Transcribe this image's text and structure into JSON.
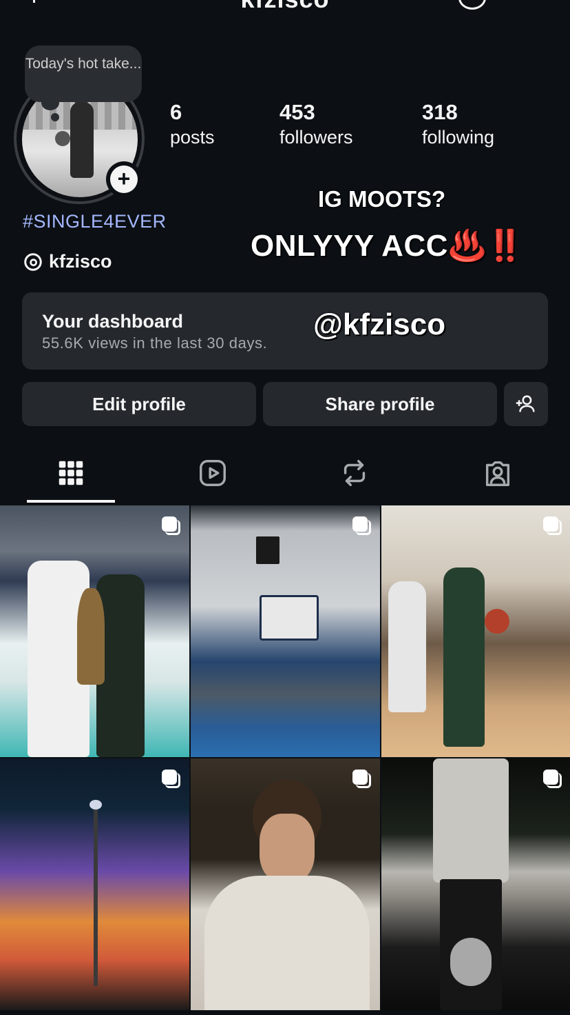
{
  "header": {
    "username_title": "kfzisco"
  },
  "profile": {
    "note_text": "Today's hot take...",
    "add_story_symbol": "+",
    "stats": [
      {
        "value": "6",
        "label": "posts"
      },
      {
        "value": "453",
        "label": "followers"
      },
      {
        "value": "318",
        "label": "following"
      }
    ],
    "bio_hashtag": "#SINGLE4EVER",
    "threads_handle": "kfzisco"
  },
  "overlay_text": {
    "line1": "IG MOOTS?",
    "line2": "ONLYYY ACC♨️‼️",
    "handle": "@kfzisco"
  },
  "dashboard": {
    "title": "Your dashboard",
    "subtitle": "55.6K views in the last 30 days."
  },
  "buttons": {
    "edit_profile": "Edit profile",
    "share_profile": "Share profile"
  },
  "tabs": [
    {
      "icon": "grid-icon",
      "selected": true
    },
    {
      "icon": "reels-icon",
      "selected": false
    },
    {
      "icon": "reposts-icon",
      "selected": false
    },
    {
      "icon": "tagged-icon",
      "selected": false
    }
  ],
  "posts": [
    {
      "type": "carousel"
    },
    {
      "type": "carousel"
    },
    {
      "type": "carousel"
    },
    {
      "type": "carousel"
    },
    {
      "type": "carousel"
    },
    {
      "type": "carousel"
    }
  ],
  "colors": {
    "background": "#0c1014",
    "surface": "#25292e",
    "hashtag": "#a5b8ff",
    "text": "#f5f5f5"
  }
}
